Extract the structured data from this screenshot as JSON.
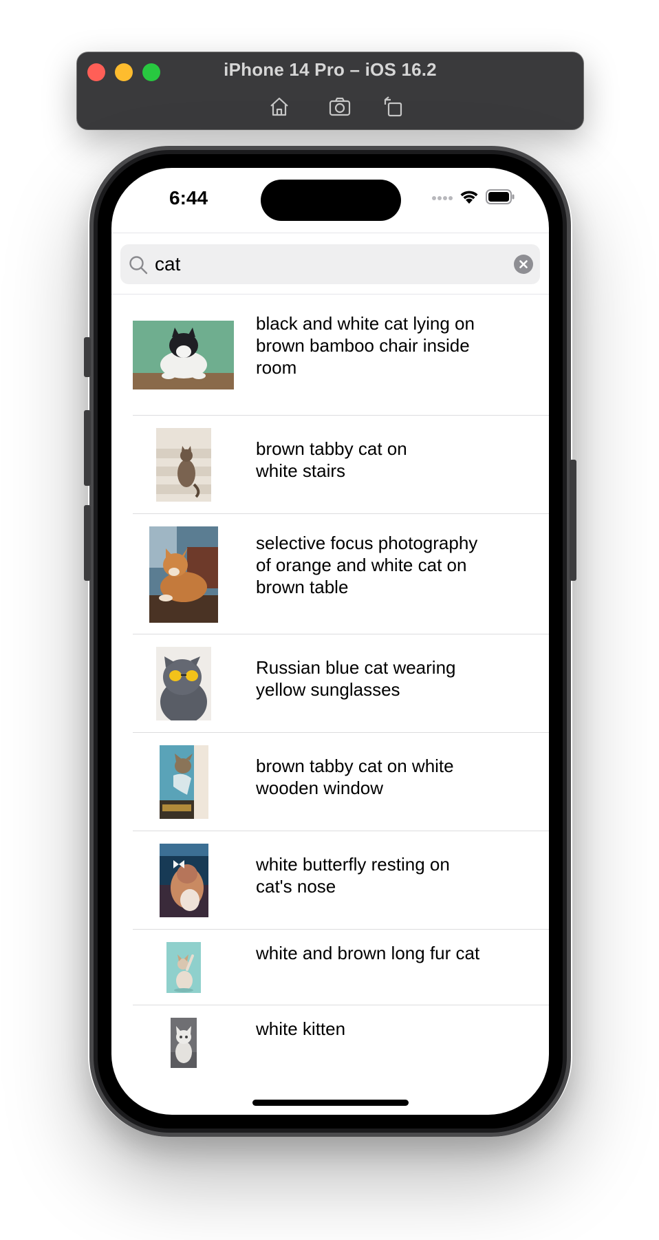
{
  "simulator": {
    "title": "iPhone 14 Pro – iOS 16.2",
    "tools": [
      "home-icon",
      "screenshot-icon",
      "rotate-icon"
    ]
  },
  "status_bar": {
    "time": "6:44",
    "icons": [
      "signal-dots-icon",
      "wifi-icon",
      "battery-icon"
    ]
  },
  "search": {
    "value": "cat",
    "placeholder": "Search"
  },
  "results": [
    {
      "label": "black and white cat lying on\nbrown bamboo chair inside\nroom",
      "image": "black-white-cat-photo"
    },
    {
      "label": "brown tabby cat on\nwhite stairs",
      "image": "tabby-cat-stairs-photo"
    },
    {
      "label": "selective focus photography\nof orange and white cat on\nbrown table",
      "image": "orange-cat-table-photo"
    },
    {
      "label": "Russian blue cat wearing\nyellow sunglasses",
      "image": "cat-sunglasses-photo"
    },
    {
      "label": "brown tabby cat on white\nwooden window",
      "image": "cat-window-photo"
    },
    {
      "label": "white butterfly resting on\ncat's nose",
      "image": "butterfly-cat-photo"
    },
    {
      "label": "white and brown long fur cat",
      "image": "long-fur-cat-photo"
    },
    {
      "label": "white kitten",
      "image": "white-kitten-photo"
    }
  ],
  "colors": {
    "titlebar": "#3a3a3c",
    "close": "#ff5f57",
    "minimize": "#febc2e",
    "zoom": "#28c840",
    "search_field": "#efeff0",
    "separator": "#dcdcde"
  }
}
